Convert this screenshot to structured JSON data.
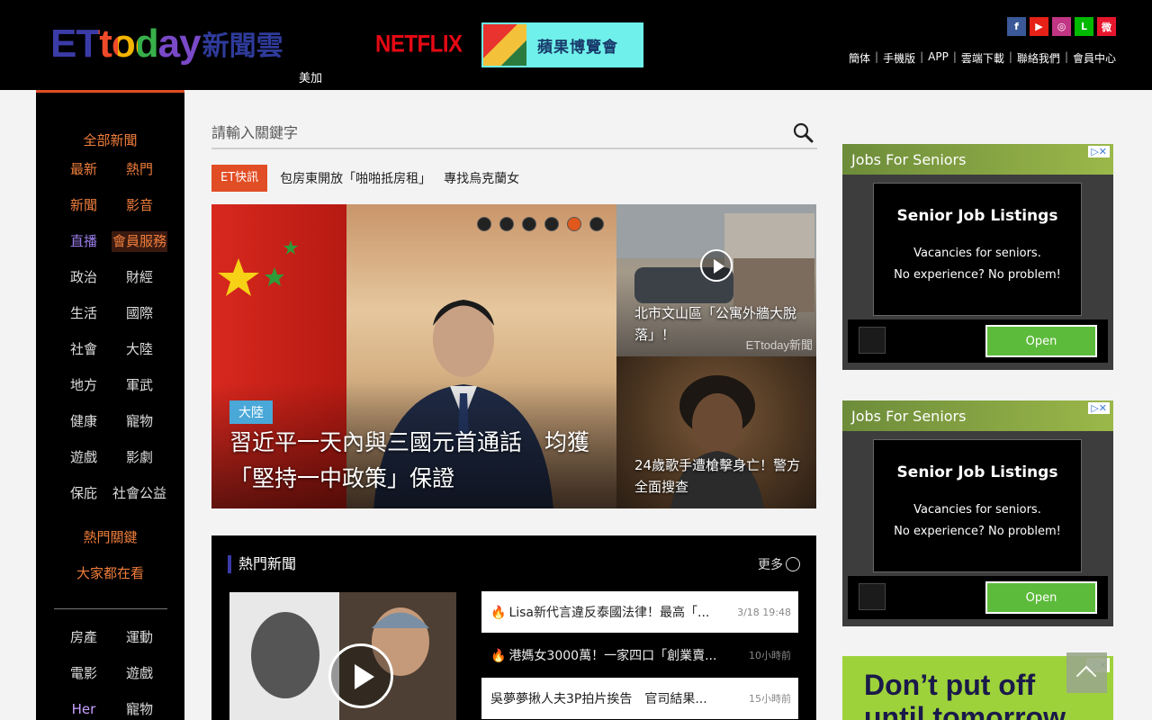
{
  "header": {
    "logo_et": "ETtoday",
    "logo_cn": "新聞雲",
    "logo_sub": "美加",
    "netflix": "NETFLIX",
    "banner_text": "蘋果博覽會",
    "social": [
      {
        "name": "facebook",
        "glyph": "f",
        "color": "#3b5998"
      },
      {
        "name": "youtube",
        "glyph": "▶",
        "color": "#e62117"
      },
      {
        "name": "instagram",
        "glyph": "◎",
        "color": "#c13584"
      },
      {
        "name": "line",
        "glyph": "L",
        "color": "#00b900"
      },
      {
        "name": "weibo",
        "glyph": "微",
        "color": "#e6162d"
      }
    ],
    "links": [
      "簡体",
      "手機版",
      "APP",
      "雲端下載",
      "聯絡我們",
      "會員中心"
    ]
  },
  "leftnav": {
    "main_category": "全部新聞",
    "items": [
      {
        "label": "最新",
        "style": "hot"
      },
      {
        "label": "熱門",
        "style": "hot"
      },
      {
        "label": "新聞",
        "style": "hot"
      },
      {
        "label": "影音",
        "style": "hot"
      },
      {
        "label": "直播",
        "style": "purple"
      },
      {
        "label": "會員服務",
        "style": "hl"
      },
      {
        "label": "政治",
        "style": ""
      },
      {
        "label": "財經",
        "style": ""
      },
      {
        "label": "生活",
        "style": ""
      },
      {
        "label": "國際",
        "style": ""
      },
      {
        "label": "社會",
        "style": ""
      },
      {
        "label": "大陸",
        "style": ""
      },
      {
        "label": "地方",
        "style": ""
      },
      {
        "label": "軍武",
        "style": ""
      },
      {
        "label": "健康",
        "style": ""
      },
      {
        "label": "寵物",
        "style": ""
      },
      {
        "label": "遊戲",
        "style": ""
      },
      {
        "label": "影劇",
        "style": ""
      },
      {
        "label": "保庇",
        "style": ""
      },
      {
        "label": "社會公益",
        "style": ""
      }
    ],
    "special_1": "熱門關鍵",
    "special_2": "大家都在看",
    "items_2": [
      {
        "label": "房產",
        "style": ""
      },
      {
        "label": "運動",
        "style": ""
      },
      {
        "label": "電影",
        "style": ""
      },
      {
        "label": "遊戲",
        "style": ""
      },
      {
        "label": "Her",
        "style": "purple"
      },
      {
        "label": "寵物",
        "style": ""
      }
    ]
  },
  "search": {
    "placeholder": "請輸入關鍵字"
  },
  "breaking": {
    "tag": "ET快訊",
    "items": [
      "包房東開放「啪啪抵房租」",
      "專找烏克蘭女"
    ]
  },
  "hero": {
    "label": "大陸",
    "headline": "習近平一天內與三國元首通話　均獲「堅持一中政策」保證",
    "dots_total": 6,
    "dots_active": 5
  },
  "side_stories": [
    {
      "text": "北市文山區「公寓外牆大脫落」！",
      "watermark": "ETtoday新聞"
    },
    {
      "text": "24歲歌手遭槍擊身亡！警方全面搜查"
    }
  ],
  "hotnews": {
    "title": "熱門新聞",
    "more": "更多",
    "items": [
      {
        "text": "Lisa新代言違反泰國法律！最高「...",
        "time": "3/18 19:48",
        "flame": true,
        "style": "light"
      },
      {
        "text": "港媽女3000萬！一家四口「創業賣...",
        "time": "10小時前",
        "flame": true,
        "style": "dark"
      },
      {
        "text": "吳夢夢揪人夫3P拍片挨告　官司結果...",
        "time": "15小時前",
        "flame": false,
        "style": "light"
      }
    ]
  },
  "ads": [
    {
      "header": "Jobs For Seniors",
      "title": "Senior Job Listings",
      "line1": "Vacancies for seniors.",
      "line2": "No experience? No problem!",
      "cta": "Open"
    },
    {
      "header": "Jobs For Seniors",
      "title": "Senior Job Listings",
      "line1": "Vacancies for seniors.",
      "line2": "No experience? No problem!",
      "cta": "Open"
    }
  ],
  "ad3": {
    "line1": "Don’t put off",
    "line2": "until tomorrow"
  }
}
